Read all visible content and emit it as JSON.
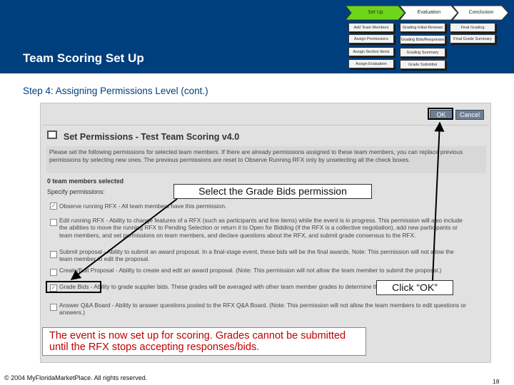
{
  "slide": {
    "title": "Team Scoring Set Up",
    "subtitle": "Step 4: Assigning Permissions Level (cont.)",
    "footer": "© 2004 MyFloridaMarketPlace. All rights reserved.",
    "page_number": "18"
  },
  "process": {
    "phases": [
      "Set Up",
      "Evaluation",
      "Conclusion"
    ],
    "setup_steps": [
      "Add Team Members",
      "Assign Permissions",
      "Assign Section Items",
      "Assign Evaluation"
    ],
    "evaluation_steps": [
      "Grading Initial Reviews",
      "Grading Bids/Responses",
      "Grading Summary",
      "Grade Submittal"
    ],
    "conclusion_steps": [
      "Final Grading",
      "Final Grade Summary"
    ]
  },
  "screenshot": {
    "ok_label": "OK",
    "cancel_label": "Cancel",
    "window_title": "Set Permissions - Test Team Scoring v4.0",
    "instructions": "Please set the following permissions for selected team members. If there are already permissions assigned to these team members, you can replace previous permissions by selecting new ones. The previous permissions are reset to Observe Running RFX only by unselecting all the check boxes.",
    "team_selected": "0 team members selected",
    "specify_label": "Specify permissions:",
    "permissions": [
      {
        "text": "Observe running RFX - All team members have this permission.",
        "checked": true
      },
      {
        "text": "Edit running RFX - Ability to change features of a RFX (such as participants and line items) while the event is in progress. This permission will also include the abilities to move the running RFX to Pending Selection or return it to Open for Bidding (if the RFX is a collective negotiation), add new participants or team members, and set permissions on team members, and declare questions about the RFX, and submit grade consensus to the RFX.",
        "checked": false
      },
      {
        "text": "Submit proposal - Ability to submit an award proposal. In a final-stage event, these bids will be the final awards. Note: This permission will not allow the team member to edit the proposal.",
        "checked": false
      },
      {
        "text": "Create/Edit Proposal - Ability to create and edit an award proposal. (Note: This permission will not allow the team member to submit the proposal.)",
        "checked": false
      },
      {
        "text": "Grade Bids - Ability to grade supplier bids. These grades will be averaged with other team member grades to determine the consensus score.",
        "checked": true
      },
      {
        "text": "Answer Q&A Board - Ability to answer questions posted to the RFX Q&A Board. (Note: This permission will not allow the team members to edit questions or answers.)",
        "checked": false
      }
    ]
  },
  "callouts": {
    "grade_bids": "Select the Grade Bids permission",
    "ok": "Click “OK”",
    "note": "The event is now set up for scoring. Grades cannot be submitted until the RFX stops accepting responses/bids."
  },
  "colors": {
    "header": "#003f7d",
    "phase_active": "#6dd61c",
    "phase_inactive": "#ffffff",
    "note_text": "#c00000"
  }
}
